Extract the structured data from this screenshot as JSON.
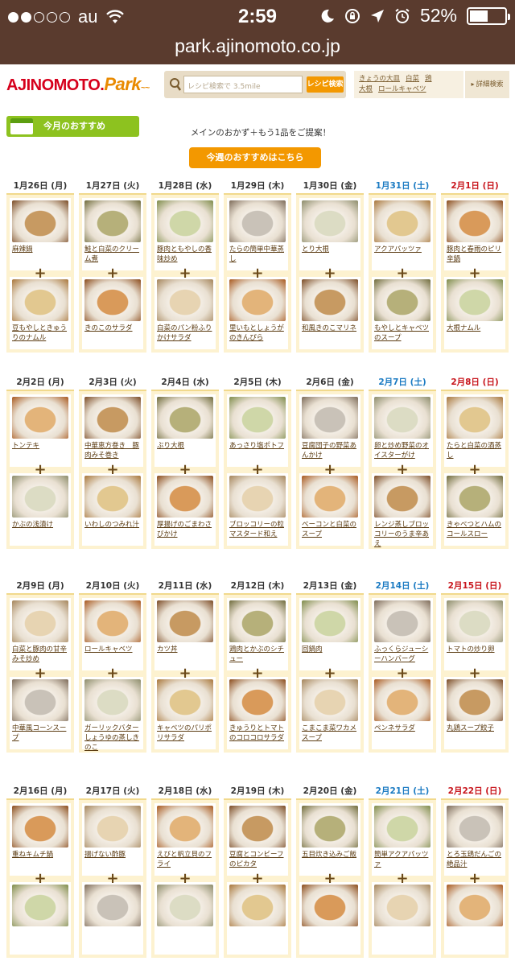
{
  "status_bar": {
    "carrier": "au",
    "time": "2:59",
    "battery": "52%",
    "battery_level": 0.52
  },
  "browser": {
    "url": "park.ajinomoto.co.jp"
  },
  "header": {
    "logo_main": "AJINOMOTO.",
    "logo_park": "Park",
    "search_placeholder": "レシピ検索で 3.5mile",
    "search_button": "レシピ検索",
    "hot_words": [
      "きょうの大皿",
      "白菜",
      "鶏",
      "大根",
      "ロールキャベツ"
    ],
    "detail_link": "詳細検索"
  },
  "section": {
    "monthly_tab": "今月のおすすめ",
    "subtitle": "メインのおかず＋もう1品をご提案！",
    "weekly_button": "今週のおすすめはこちら"
  },
  "colors": {
    "accent_orange": "#f39800",
    "green_tab": "#8dc21f",
    "sat_blue": "#1a7ac2",
    "sun_red": "#c8161d",
    "cell_bg": "#fdf2d0"
  },
  "weeks": [
    {
      "days": [
        {
          "date": "1月26日 (月)",
          "type": "weekday",
          "main": "麻辣鍋",
          "side": "豆もやしときゅうりのナムル"
        },
        {
          "date": "1月27日 (火)",
          "type": "weekday",
          "main": "鮭と白菜のクリーム煮",
          "side": "きのこのサラダ"
        },
        {
          "date": "1月28日 (水)",
          "type": "weekday",
          "main": "豚肉ともやしの香味炒め",
          "side": "白菜のパン粉ふりかけサラダ"
        },
        {
          "date": "1月29日 (木)",
          "type": "weekday",
          "main": "たらの簡単中華蒸し",
          "side": "里いもとしょうがのきんぴら"
        },
        {
          "date": "1月30日 (金)",
          "type": "weekday",
          "main": "とり大根",
          "side": "和風きのこマリネ"
        },
        {
          "date": "1月31日 (土)",
          "type": "sat",
          "main": "アクアパッツァ",
          "side": "もやしとキャベツのスープ"
        },
        {
          "date": "2月1日 (日)",
          "type": "sun",
          "main": "豚肉と春雨のピリ辛鍋",
          "side": "大根ナムル"
        }
      ]
    },
    {
      "days": [
        {
          "date": "2月2日 (月)",
          "type": "weekday",
          "main": "トンテキ",
          "side": "かぶの浅漬け"
        },
        {
          "date": "2月3日 (火)",
          "type": "weekday",
          "main": "中華恵方巻き　豚肉みそ巻き",
          "side": "いわしのつみれ汁"
        },
        {
          "date": "2月4日 (水)",
          "type": "weekday",
          "main": "ぶり大根",
          "side": "厚揚げのごまわさびかけ"
        },
        {
          "date": "2月5日 (木)",
          "type": "weekday",
          "main": "あっさり塩ポトフ",
          "side": "ブロッコリーの粒マスタード和え"
        },
        {
          "date": "2月6日 (金)",
          "type": "weekday",
          "main": "豆腐団子の野菜あんかけ",
          "side": "ベーコンと白菜のスープ"
        },
        {
          "date": "2月7日 (土)",
          "type": "sat",
          "main": "卵と炒め野菜のオイスターがけ",
          "side": "レンジ蒸しブロッコリーのうま辛あえ"
        },
        {
          "date": "2月8日 (日)",
          "type": "sun",
          "main": "たらと白菜の酒蒸し",
          "side": "きゃべつとハムのコールスロー"
        }
      ]
    },
    {
      "days": [
        {
          "date": "2月9日 (月)",
          "type": "weekday",
          "main": "白菜と豚肉の甘辛みそ炒め",
          "side": "中華風コーンスープ"
        },
        {
          "date": "2月10日 (火)",
          "type": "weekday",
          "main": "ロールキャベツ",
          "side": "ガーリックバターしょうゆの蒸しきのこ"
        },
        {
          "date": "2月11日 (水)",
          "type": "weekday",
          "main": "カツ丼",
          "side": "キャベツのパリポリサラダ"
        },
        {
          "date": "2月12日 (木)",
          "type": "weekday",
          "main": "鶏肉とかぶのシチュー",
          "side": "きゅうりとトマトのコロコロサラダ"
        },
        {
          "date": "2月13日 (金)",
          "type": "weekday",
          "main": "回鍋肉",
          "side": "こまこま菜ワカメスープ"
        },
        {
          "date": "2月14日 (土)",
          "type": "sat",
          "main": "ふっくらジューシーハンバーグ",
          "side": "ペンネサラダ"
        },
        {
          "date": "2月15日 (日)",
          "type": "sun",
          "main": "トマトの炒り卵",
          "side": "丸鶏スープ餃子"
        }
      ]
    },
    {
      "days": [
        {
          "date": "2月16日 (月)",
          "type": "weekday",
          "main": "重ねキムチ鍋",
          "side": ""
        },
        {
          "date": "2月17日 (火)",
          "type": "weekday",
          "main": "揚げない酢豚",
          "side": ""
        },
        {
          "date": "2月18日 (水)",
          "type": "weekday",
          "main": "えびと帆立貝のフライ",
          "side": ""
        },
        {
          "date": "2月19日 (木)",
          "type": "weekday",
          "main": "豆腐とコンビーフのピカタ",
          "side": ""
        },
        {
          "date": "2月20日 (金)",
          "type": "weekday",
          "main": "五目炊き込みご飯",
          "side": ""
        },
        {
          "date": "2月21日 (土)",
          "type": "sat",
          "main": "簡単アクアパッツァ",
          "side": ""
        },
        {
          "date": "2月22日 (日)",
          "type": "sun",
          "main": "とろ玉鶏だんごの絶品汁",
          "side": ""
        }
      ]
    }
  ]
}
